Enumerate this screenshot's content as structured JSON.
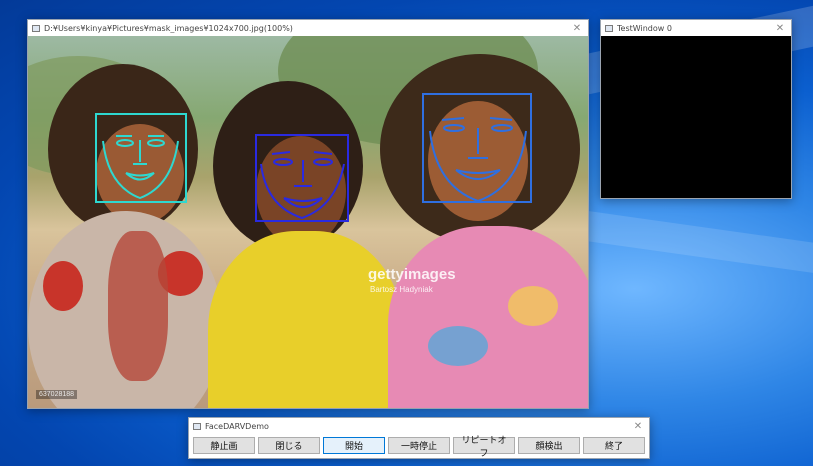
{
  "image_window": {
    "title": "D:¥Users¥kinya¥Pictures¥mask_images¥1024x700.jpg(100%)",
    "watermark_brand": "gettyimages",
    "watermark_credit": "Bartosz Hadyniak",
    "image_id": "637028188"
  },
  "test_window": {
    "title": "TestWindow 0"
  },
  "control_window": {
    "title": "FaceDARVDemo",
    "buttons": [
      "静止画",
      "閉じる",
      "開始",
      "一時停止",
      "リピートオフ",
      "顔検出",
      "終了"
    ]
  },
  "colors": {
    "face1": "#2ed8d0",
    "face2": "#2a2ae0",
    "face3": "#2f6fe0",
    "test_bg": "#000000"
  }
}
